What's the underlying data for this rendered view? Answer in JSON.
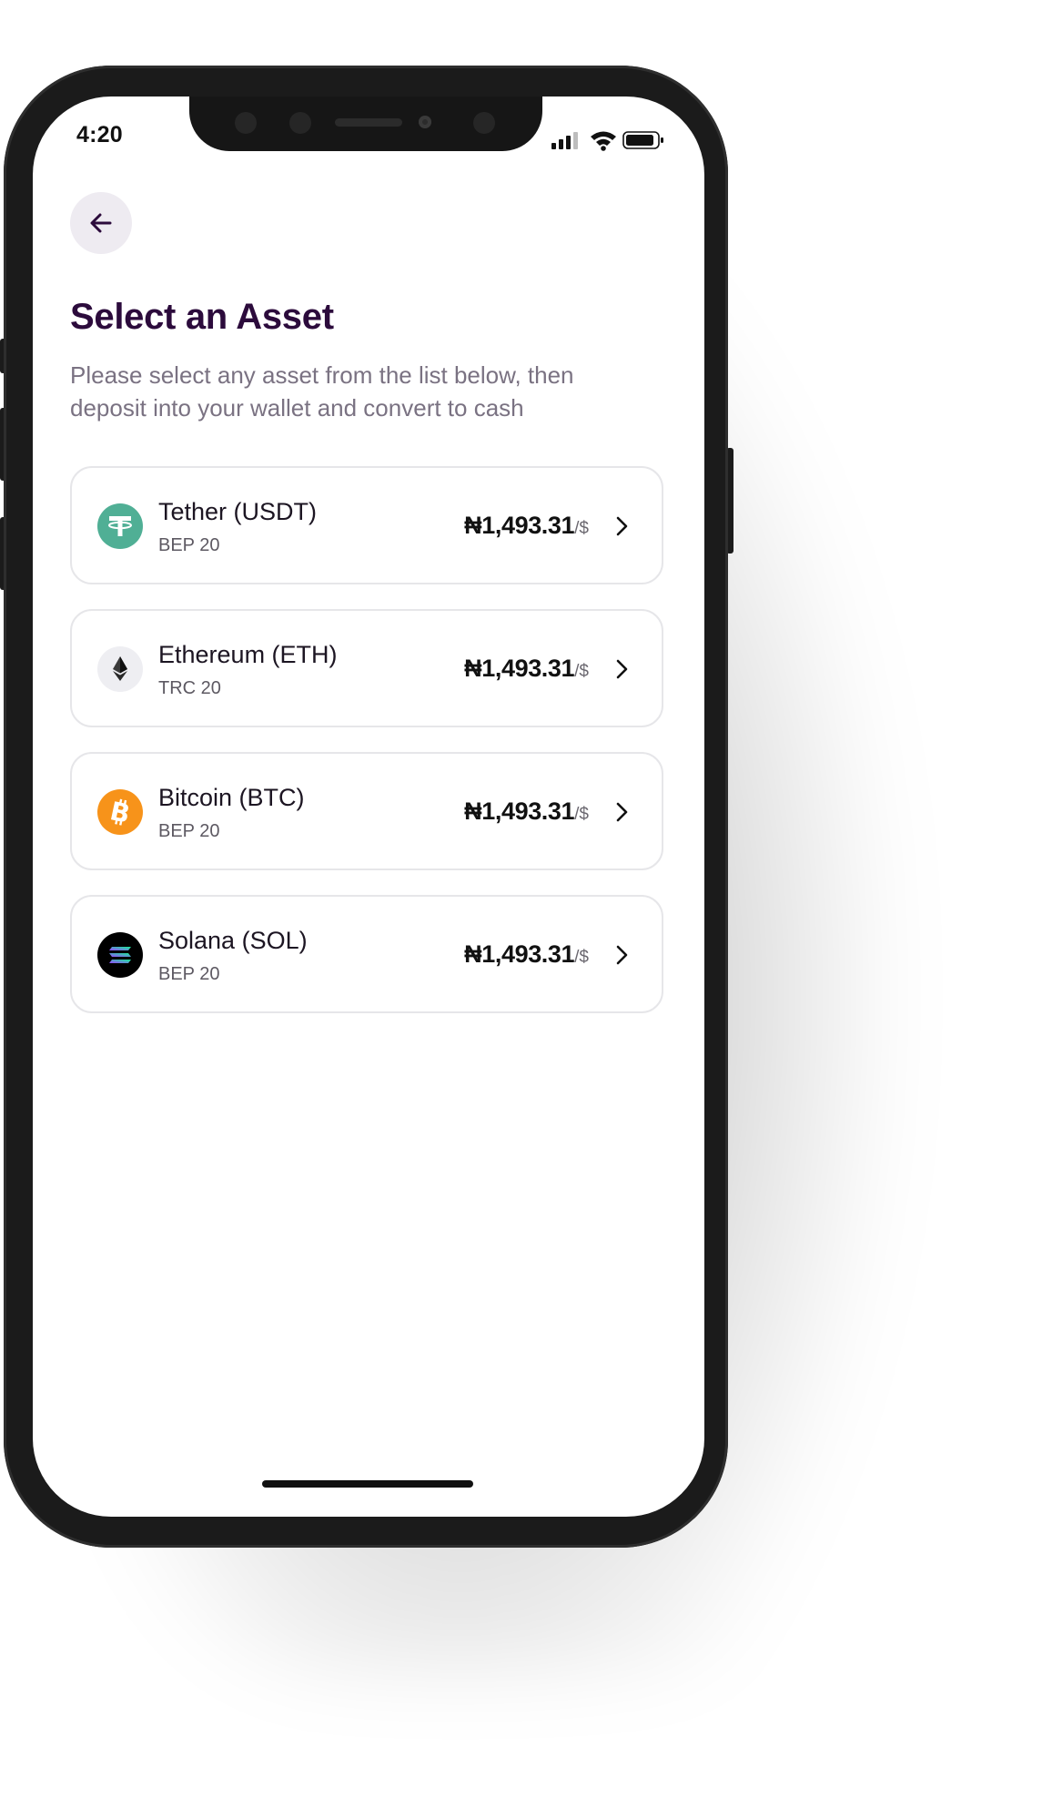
{
  "status_bar": {
    "time": "4:20",
    "icons": [
      "cellular-signal-icon",
      "wifi-icon",
      "battery-icon"
    ]
  },
  "header": {
    "back_icon": "arrow-left-icon",
    "title": "Select an Asset",
    "subtitle": "Please select any asset from the list below, then deposit into your wallet and convert to cash"
  },
  "assets": [
    {
      "name": "Tether (USDT)",
      "network": "BEP 20",
      "rate": "₦1,493.31",
      "unit": "/$",
      "icon": "tether-icon",
      "color": "#50AF95"
    },
    {
      "name": "Ethereum (ETH)",
      "network": "TRC 20",
      "rate": "₦1,493.31",
      "unit": "/$",
      "icon": "ethereum-icon",
      "color": "#EEEEF2"
    },
    {
      "name": "Bitcoin (BTC)",
      "network": "BEP 20",
      "rate": "₦1,493.31",
      "unit": "/$",
      "icon": "bitcoin-icon",
      "color": "#F7931A"
    },
    {
      "name": "Solana (SOL)",
      "network": "BEP 20",
      "rate": "₦1,493.31",
      "unit": "/$",
      "icon": "solana-icon",
      "color": "#000000"
    }
  ],
  "colors": {
    "title": "#2C0B3C",
    "subtitle": "#7A7282",
    "card_border": "#E6E6E9",
    "back_button_bg": "#EEEBF1"
  }
}
